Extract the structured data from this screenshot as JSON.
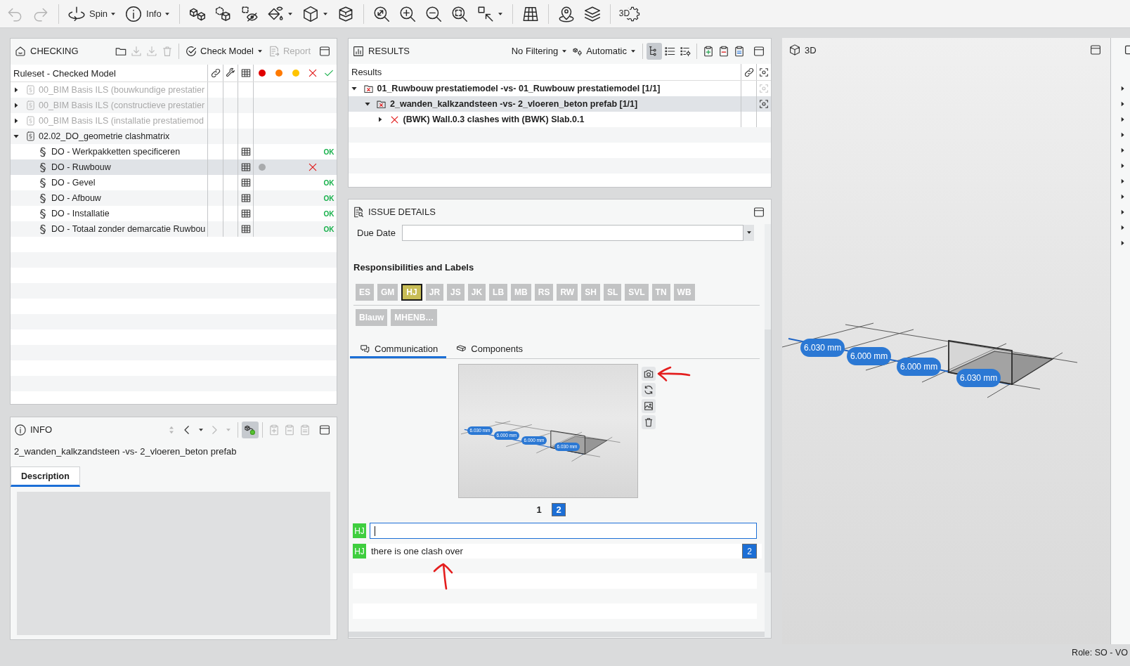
{
  "toolbar": {
    "undo": {
      "disabled": true
    },
    "redo": {
      "disabled": true
    },
    "spin": {
      "label": "Spin"
    },
    "info": {
      "label": "Info"
    },
    "view_settings": {
      "label": "3D"
    }
  },
  "checking": {
    "title": "CHECKING",
    "tools": {
      "open": {
        "disabled": false
      },
      "import": {
        "disabled": true
      },
      "import_all": {
        "disabled": true
      },
      "delete": {
        "disabled": true
      }
    },
    "check_model": {
      "label": "Check Model"
    },
    "report": {
      "label": "Report",
      "disabled": true
    },
    "table": {
      "header": "Ruleset - Checked Model",
      "severity_columns": [
        {
          "color": "#e00000"
        },
        {
          "color": "#ff7a00"
        },
        {
          "color": "#ffc400"
        }
      ],
      "rows": [
        {
          "kind": "ruleset",
          "name": "00_BIM Basis ILS (bouwkundige prestatier",
          "disabled": true,
          "expanded": false,
          "selected": false
        },
        {
          "kind": "ruleset",
          "name": "00_BIM Basis ILS (constructieve prestatier",
          "disabled": true,
          "expanded": false,
          "selected": false
        },
        {
          "kind": "ruleset",
          "name": "00_BIM Basis ILS (installatie prestatiemod",
          "disabled": true,
          "expanded": false,
          "selected": false
        },
        {
          "kind": "ruleset",
          "name": "02.02_DO_geometrie clashmatrix",
          "disabled": false,
          "expanded": true,
          "selected": false,
          "children": [
            {
              "kind": "rule",
              "name": "DO - Werkpakketten specificeren",
              "selected": false,
              "issue_dot": false,
              "passed": true,
              "status_text": "OK"
            },
            {
              "kind": "rule",
              "name": "DO - Ruwbouw",
              "selected": true,
              "issue_dot": true,
              "passed": false
            },
            {
              "kind": "rule",
              "name": "DO - Gevel",
              "selected": false,
              "issue_dot": false,
              "passed": true,
              "status_text": "OK"
            },
            {
              "kind": "rule",
              "name": "DO - Afbouw",
              "selected": false,
              "issue_dot": false,
              "passed": true,
              "status_text": "OK"
            },
            {
              "kind": "rule",
              "name": "DO - Installatie",
              "selected": false,
              "issue_dot": false,
              "passed": true,
              "status_text": "OK"
            },
            {
              "kind": "rule",
              "name": "DO - Totaal zonder demarcatie Ruwbou",
              "selected": false,
              "issue_dot": false,
              "passed": true,
              "status_text": "OK"
            }
          ]
        }
      ]
    }
  },
  "info": {
    "title": "INFO",
    "tools": {
      "sort": {
        "disabled": true
      },
      "back": {
        "disabled": false
      },
      "back_menu": {
        "disabled": false
      },
      "forward": {
        "disabled": true
      },
      "forward_menu": {
        "disabled": true
      },
      "show_in_model": {
        "on": true
      },
      "add": {
        "disabled": true
      },
      "remove": {
        "disabled": true
      },
      "list": {
        "disabled": true
      }
    },
    "subject": "2_wanden_kalkzandsteen -vs- 2_vloeren_beton prefab",
    "tabs": [
      {
        "label": "Description",
        "selected": true
      }
    ]
  },
  "results": {
    "title": "RESULTS",
    "filter": {
      "label": "No Filtering"
    },
    "mode": {
      "label": "Automatic"
    },
    "tools": {
      "tree_view": {
        "on": true
      },
      "list_view": {
        "on": false
      },
      "list_settings": {
        "on": false
      },
      "add": {
        "disabled": false
      },
      "remove": {
        "disabled": false
      },
      "list": {
        "disabled": false
      }
    },
    "table": {
      "header": "Results",
      "rows": [
        {
          "kind": "group",
          "name": "01_Ruwbouw prestatiemodel -vs- 01_Ruwbouw prestatiemodel [1/1]",
          "expanded": true,
          "selected": false,
          "focus_disabled": true,
          "children": [
            {
              "kind": "group",
              "name": "2_wanden_kalkzandsteen -vs- 2_vloeren_beton prefab [1/1]",
              "expanded": true,
              "selected": true,
              "focus_disabled": false,
              "children": [
                {
                  "kind": "clash",
                  "name": "(BWK) Wall.0.3 clashes with (BWK) Slab.0.1",
                  "expanded": false,
                  "selected": false
                }
              ]
            }
          ]
        }
      ]
    }
  },
  "issue_details": {
    "title": "ISSUE DETAILS",
    "due_date": {
      "label": "Due Date"
    },
    "responsibilities": {
      "title": "Responsibilities and Labels",
      "people": [
        {
          "label": "ES",
          "selected": false
        },
        {
          "label": "GM",
          "selected": false
        },
        {
          "label": "HJ",
          "selected": true
        },
        {
          "label": "JR",
          "selected": false
        },
        {
          "label": "JS",
          "selected": false
        },
        {
          "label": "JK",
          "selected": false
        },
        {
          "label": "LB",
          "selected": false
        },
        {
          "label": "MB",
          "selected": false
        },
        {
          "label": "RS",
          "selected": false
        },
        {
          "label": "RW",
          "selected": false
        },
        {
          "label": "SH",
          "selected": false
        },
        {
          "label": "SL",
          "selected": false
        },
        {
          "label": "SVL",
          "selected": false
        },
        {
          "label": "TN",
          "selected": false
        },
        {
          "label": "WB",
          "selected": false
        }
      ],
      "labels": [
        {
          "label": "Blauw",
          "selected": false
        },
        {
          "label": "MHENB…",
          "selected": false
        }
      ]
    },
    "tabs": [
      {
        "label": "Communication",
        "selected": true
      },
      {
        "label": "Components",
        "selected": false
      }
    ],
    "snapshot": {
      "measurements": [
        "6.030 mm",
        "6.000 mm",
        "6.000 mm",
        "6.030 mm"
      ]
    },
    "pages": [
      {
        "label": "1",
        "selected": false
      },
      {
        "label": "2",
        "selected": true
      }
    ],
    "comment_input": {
      "author": "HJ",
      "focused": true
    },
    "comments": [
      {
        "author": "HJ",
        "text": "there is one clash over",
        "page": "2"
      }
    ]
  },
  "viewport_3d": {
    "title": "3D",
    "measurements": [
      "6.030 mm",
      "6.000 mm",
      "6.000 mm",
      "6.030 mm"
    ]
  },
  "side_strip": {
    "rows": [
      {
        "expanded": false
      },
      {
        "expanded": false
      },
      {
        "expanded": false
      },
      {
        "expanded": false
      },
      {
        "expanded": false
      },
      {
        "expanded": false
      },
      {
        "expanded": false
      },
      {
        "expanded": false
      },
      {
        "expanded": false
      },
      {
        "expanded": false
      },
      {
        "expanded": false
      }
    ]
  },
  "status_bar": {
    "role": "Role: SO - VO"
  }
}
